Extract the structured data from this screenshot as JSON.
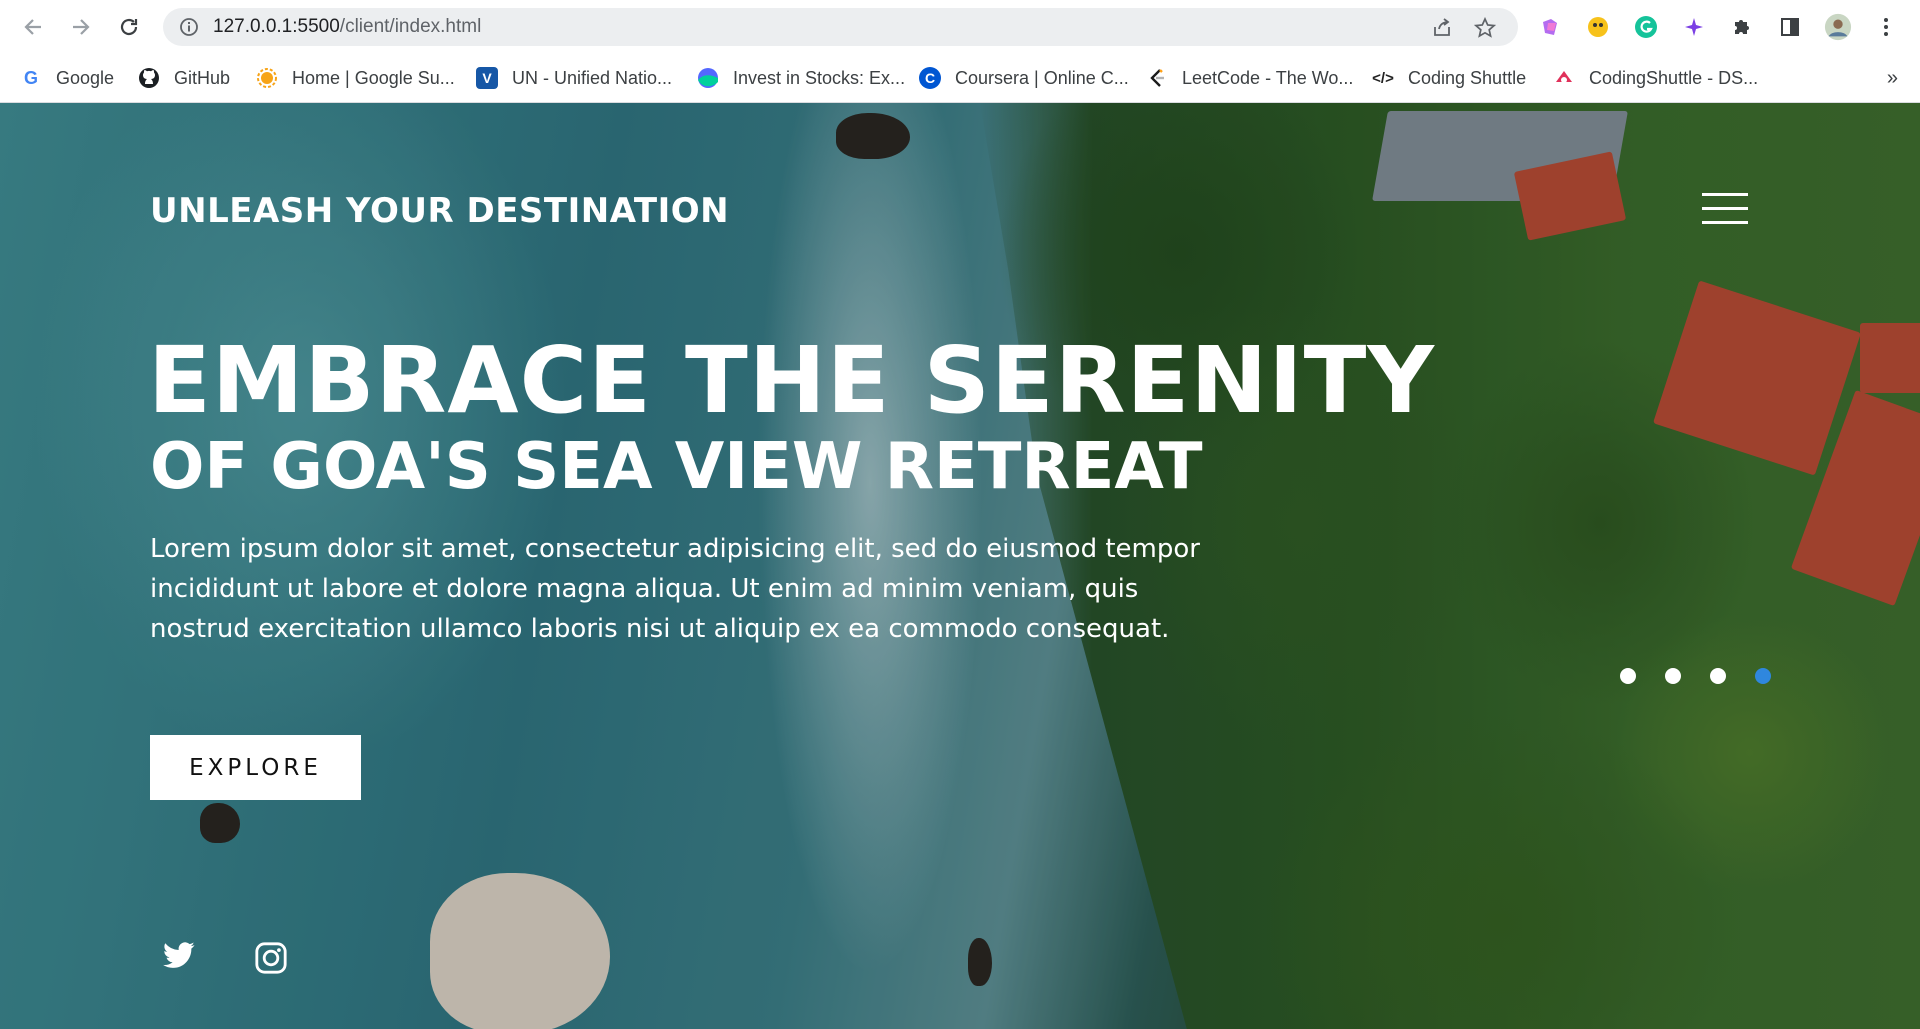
{
  "browser": {
    "url_host": "127.0.0.1:5500",
    "url_path": "/client/index.html",
    "bookmarks": [
      {
        "label": "Google",
        "icon": "google-icon"
      },
      {
        "label": "GitHub",
        "icon": "github-icon"
      },
      {
        "label": "Home | Google Su...",
        "icon": "google-summer-icon"
      },
      {
        "label": "UN - Unified Natio...",
        "icon": "un-icon"
      },
      {
        "label": "Invest in Stocks: Ex...",
        "icon": "invest-icon"
      },
      {
        "label": "Coursera | Online C...",
        "icon": "coursera-icon"
      },
      {
        "label": "LeetCode - The Wo...",
        "icon": "leetcode-icon"
      },
      {
        "label": "Coding Shuttle",
        "icon": "code-icon"
      },
      {
        "label": "CodingShuttle - DS...",
        "icon": "codingshuttle-icon"
      }
    ],
    "more": "»"
  },
  "page": {
    "brand": "UNLEASH YOUR DESTINATION",
    "headline": "EMBRACE THE SERENITY",
    "subheadline": "OF GOA'S SEA VIEW RETREAT",
    "body": "Lorem ipsum dolor sit amet, consectetur adipisicing elit, sed do eiusmod tempor incididunt ut labore et dolore magna aliqua. Ut enim ad minim veniam, quis nostrud exercitation ullamco laboris nisi ut aliquip ex ea commodo consequat.",
    "cta": "EXPLORE",
    "slider": {
      "count": 4,
      "active_index": 3
    },
    "social": [
      "twitter-icon",
      "instagram-icon"
    ],
    "colors": {
      "accent_dot": "#2f87de",
      "text": "#ffffff",
      "button_bg": "#ffffff"
    }
  }
}
